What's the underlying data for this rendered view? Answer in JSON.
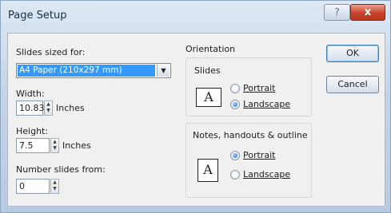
{
  "window": {
    "title": "Page Setup",
    "help_label": "?",
    "close_label": "x"
  },
  "left": {
    "slides_sized_label": "Slides sized for:",
    "slides_sized_value": "A4 Paper (210x297 mm)",
    "width_label": "Width:",
    "width_value": "10.83",
    "width_unit": "Inches",
    "height_label": "Height:",
    "height_value": "7.5",
    "height_unit": "Inches",
    "number_from_label": "Number slides from:",
    "number_from_value": "0"
  },
  "orientation": {
    "label": "Orientation",
    "slides": {
      "label": "Slides",
      "page_glyph": "A",
      "options": [
        "Portrait",
        "Landscape"
      ],
      "selected": "Landscape"
    },
    "notes": {
      "label": "Notes, handouts & outline",
      "page_glyph": "A",
      "options": [
        "Portrait",
        "Landscape"
      ],
      "selected": "Portrait"
    }
  },
  "buttons": {
    "ok": "OK",
    "cancel": "Cancel"
  },
  "icons": {
    "dropdown": "chevron-down-icon",
    "spin_up": "spin-up-icon",
    "spin_down": "spin-down-icon"
  }
}
